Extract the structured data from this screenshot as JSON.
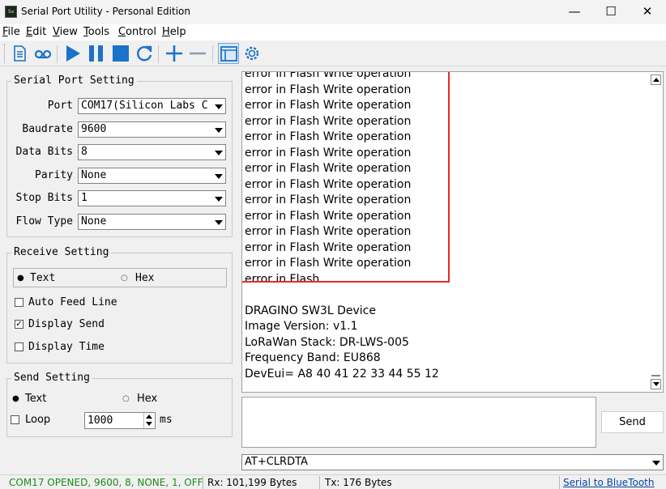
{
  "window": {
    "title": "Serial Port Utility - Personal Edition",
    "app_icon_text": "Sw",
    "minimize_glyph": "—",
    "maximize_glyph": "☐",
    "close_glyph": "✕"
  },
  "menu": {
    "file": {
      "key": "F",
      "rest": "ile"
    },
    "edit": {
      "key": "E",
      "rest": "dit"
    },
    "view": {
      "key": "V",
      "rest": "iew"
    },
    "tools": {
      "key": "T",
      "rest": "ools"
    },
    "control": {
      "key": "C",
      "rest": "ontrol"
    },
    "help": {
      "key": "H",
      "rest": "elp"
    }
  },
  "toolbar": {
    "icons": [
      "document-icon",
      "record-icon",
      "play-icon",
      "pause-icon",
      "stop-icon",
      "refresh-icon",
      "add-icon",
      "remove-icon",
      "window-icon",
      "gear-icon"
    ],
    "accent_color": "#1a73c8"
  },
  "serial_port_setting": {
    "title": "Serial Port Setting",
    "port_label": "Port",
    "port_value": "COM17(Silicon Labs C",
    "baudrate_label": "Baudrate",
    "baudrate_value": "9600",
    "data_bits_label": "Data Bits",
    "data_bits_value": "8",
    "parity_label": "Parity",
    "parity_value": "None",
    "stop_bits_label": "Stop Bits",
    "stop_bits_value": "1",
    "flow_type_label": "Flow Type",
    "flow_type_value": "None"
  },
  "receive_setting": {
    "title": "Receive Setting",
    "text_option": "Text",
    "hex_option": "Hex",
    "selected": "Text",
    "auto_feed_line": {
      "label": "Auto Feed Line",
      "checked": false
    },
    "display_send": {
      "label": "Display Send",
      "checked": true
    },
    "display_time": {
      "label": "Display Time",
      "checked": false
    }
  },
  "send_setting": {
    "title": "Send Setting",
    "text_option": "Text",
    "hex_option": "Hex",
    "selected": "Text",
    "loop": {
      "label": "Loop",
      "checked": false
    },
    "interval_value": "1000",
    "interval_unit": "ms"
  },
  "terminal": {
    "lines": [
      "error in Flash Write operation",
      "error in Flash Write operation",
      "error in Flash Write operation",
      "error in Flash Write operation",
      "error in Flash Write operation",
      "error in Flash Write operation",
      "error in Flash Write operation",
      "error in Flash Write operation",
      "error in Flash Write operation",
      "error in Flash Write operation",
      "error in Flash Write operation",
      "error in Flash Write operation",
      "error in Flash Write operation",
      "error in Flash",
      "",
      "DRAGINO SW3L Device",
      "Image Version: v1.1",
      "LoRaWan Stack: DR-LWS-005",
      "Frequency Band: EU868",
      "DevEui= A8 40 41 22 33 44 55 12"
    ],
    "highlight_color": "#e52b2b"
  },
  "send": {
    "button_label": "Send",
    "command_value": "AT+CLRDTA"
  },
  "status_bar": {
    "port_status": "COM17 OPENED, 9600, 8, NONE, 1, OFF",
    "port_status_color": "#1a8a1a",
    "rx": "Rx: 101,199 Bytes",
    "tx": "Tx: 176 Bytes",
    "link": "Serial to BlueTooth",
    "link_color": "#0645ad"
  }
}
